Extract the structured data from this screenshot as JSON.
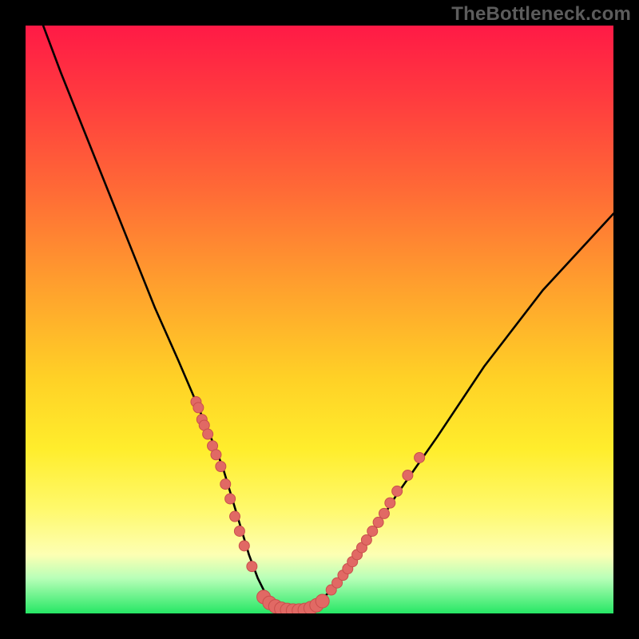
{
  "watermark": "TheBottleneck.com",
  "colors": {
    "background": "#000000",
    "gradient_top": "#ff1a46",
    "gradient_mid": "#ffed2c",
    "gradient_bottom": "#26e765",
    "curve": "#000000",
    "marker_fill": "#e16964",
    "marker_stroke": "#c94f4c"
  },
  "chart_data": {
    "type": "line",
    "title": "",
    "xlabel": "",
    "ylabel": "",
    "xlim": [
      0,
      100
    ],
    "ylim": [
      0,
      100
    ],
    "grid": false,
    "legend": false,
    "series": [
      {
        "name": "bottleneck-curve",
        "x": [
          3,
          6,
          10,
          14,
          18,
          22,
          26,
          29,
          31.5,
          33.5,
          35,
          36.5,
          38,
          39.5,
          41,
          43,
          46,
          50,
          54,
          58,
          63,
          70,
          78,
          88,
          100
        ],
        "y": [
          100,
          92,
          82,
          72,
          62,
          52,
          43,
          36,
          30,
          25,
          20,
          15,
          10,
          6,
          3,
          1,
          0.5,
          2,
          6,
          12,
          20,
          30,
          42,
          55,
          68
        ]
      }
    ],
    "markers_left": [
      {
        "x": 29.0,
        "y": 36
      },
      {
        "x": 29.4,
        "y": 35
      },
      {
        "x": 30.0,
        "y": 33
      },
      {
        "x": 30.4,
        "y": 32
      },
      {
        "x": 31.0,
        "y": 30.5
      },
      {
        "x": 31.8,
        "y": 28.5
      },
      {
        "x": 32.4,
        "y": 27
      },
      {
        "x": 33.2,
        "y": 25
      },
      {
        "x": 34.0,
        "y": 22
      },
      {
        "x": 34.8,
        "y": 19.5
      },
      {
        "x": 35.6,
        "y": 16.5
      },
      {
        "x": 36.4,
        "y": 14
      },
      {
        "x": 37.2,
        "y": 11.5
      },
      {
        "x": 38.5,
        "y": 8
      }
    ],
    "markers_bottom": [
      {
        "x": 40.5,
        "y": 2.8
      },
      {
        "x": 41.5,
        "y": 1.8
      },
      {
        "x": 42.5,
        "y": 1.2
      },
      {
        "x": 43.5,
        "y": 0.8
      },
      {
        "x": 44.5,
        "y": 0.6
      },
      {
        "x": 45.5,
        "y": 0.5
      },
      {
        "x": 46.5,
        "y": 0.5
      },
      {
        "x": 47.5,
        "y": 0.6
      },
      {
        "x": 48.5,
        "y": 0.9
      },
      {
        "x": 49.5,
        "y": 1.4
      },
      {
        "x": 50.5,
        "y": 2.1
      }
    ],
    "markers_right": [
      {
        "x": 52.0,
        "y": 4.0
      },
      {
        "x": 53.0,
        "y": 5.2
      },
      {
        "x": 54.0,
        "y": 6.5
      },
      {
        "x": 54.8,
        "y": 7.6
      },
      {
        "x": 55.6,
        "y": 8.8
      },
      {
        "x": 56.4,
        "y": 10.0
      },
      {
        "x": 57.2,
        "y": 11.2
      },
      {
        "x": 58.0,
        "y": 12.5
      },
      {
        "x": 59.0,
        "y": 14.0
      },
      {
        "x": 60.0,
        "y": 15.5
      },
      {
        "x": 61.0,
        "y": 17.0
      },
      {
        "x": 62.0,
        "y": 18.8
      },
      {
        "x": 63.2,
        "y": 20.8
      },
      {
        "x": 65.0,
        "y": 23.5
      },
      {
        "x": 67.0,
        "y": 26.5
      }
    ]
  }
}
